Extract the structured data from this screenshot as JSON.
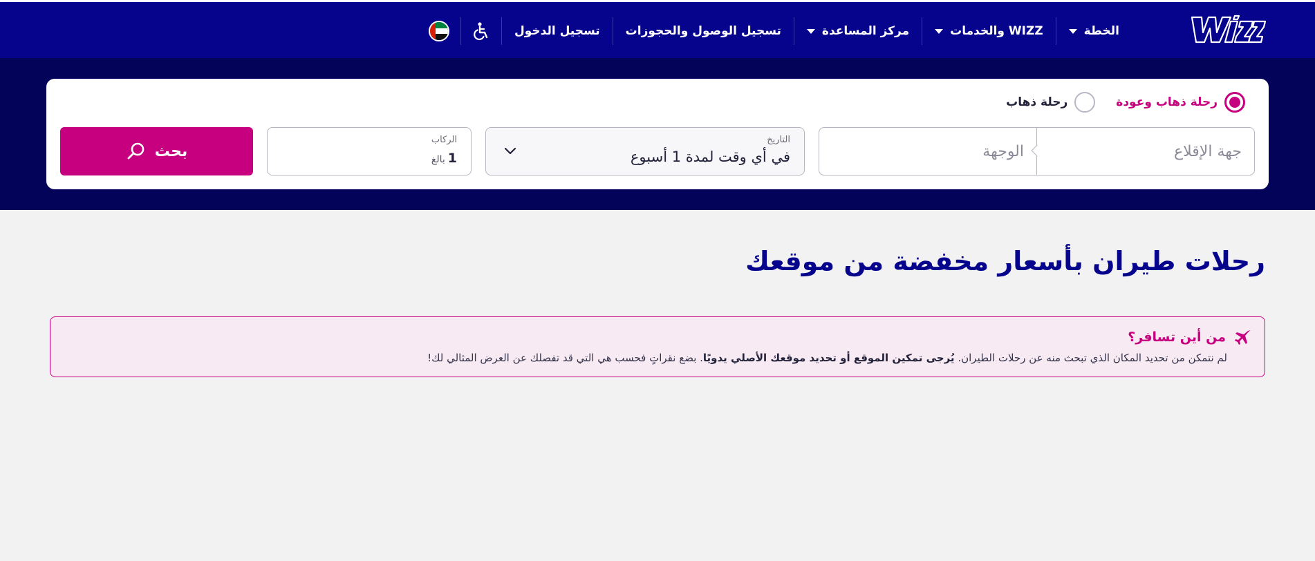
{
  "header": {
    "logo_text": "WIZZ",
    "nav": [
      {
        "label": "الخطة",
        "has_dropdown": true
      },
      {
        "label": "WIZZ والخدمات",
        "has_dropdown": true
      },
      {
        "label": "مركز المساعدة",
        "has_dropdown": true
      },
      {
        "label": "تسجيل الوصول والحجوزات",
        "has_dropdown": false
      },
      {
        "label": "تسجيل الدخول",
        "has_dropdown": false
      }
    ],
    "accessibility_icon": "wheelchair-icon",
    "language_flag": "uae-flag-icon"
  },
  "search": {
    "trip_types": [
      {
        "label": "رحلة ذهاب وعودة",
        "checked": true
      },
      {
        "label": "رحلة ذهاب",
        "checked": false
      }
    ],
    "origin_placeholder": "جهة الإقلاع",
    "destination_placeholder": "الوجهة",
    "date_label": "التاريخ",
    "date_value": "في أي وقت لمدة 1 أسبوع",
    "passengers_label": "الركاب",
    "passengers_count": "1",
    "passengers_type": "بالغ",
    "search_button": "بحث"
  },
  "main": {
    "title_regular": "رحلات طيران بأسعار مخفضة ",
    "title_bold": "من موقعك"
  },
  "notice": {
    "heading": "من أين تسافر؟",
    "text_part1": "لم نتمكن من تحديد المكان الذي تبحث منه عن رحلات الطيران. ",
    "text_bold": "يُرجى تمكين الموقع أو تحديد موقعك الأصلي يدويًا",
    "text_part2": ". بضع نقراتٍ فحسب هي التي قد تفصلك عن العرض المثالي لك!"
  },
  "colors": {
    "brand_navy": "#06038d",
    "hero_navy": "#03035a",
    "accent_magenta": "#c6007e",
    "page_bg": "#f2f2f2"
  }
}
